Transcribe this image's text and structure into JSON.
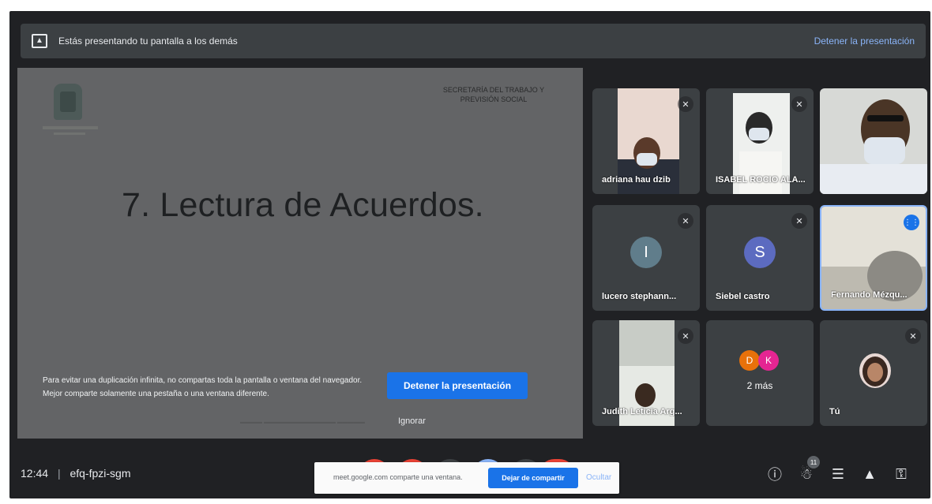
{
  "banner": {
    "text": "Estás presentando tu pantalla a los demás",
    "stop_label": "Detener la presentación"
  },
  "slide": {
    "org_name": "SECRETARÍA DEL TRABAJO Y PREVISIÓN SOCIAL",
    "title": "7. Lectura de Acuerdos.",
    "warning": "Para evitar una duplicación infinita, no compartas toda la pantalla o ventana del navegador. Mejor comparte solamente una pestaña o una ventana diferente.",
    "stop_button": "Detener la presentación",
    "ignore_label": "Ignorar"
  },
  "participants": [
    {
      "name": "adriana hau dzib",
      "muted": true
    },
    {
      "name": "ISABEL ROCIO ALA...",
      "muted": true
    },
    {
      "name": "",
      "muted": false
    },
    {
      "name": "lucero stephann...",
      "initial": "I",
      "avatar_color": "#607d8b",
      "muted": true
    },
    {
      "name": "Siebel castro",
      "initial": "S",
      "avatar_color": "#5c6bc0",
      "muted": true
    },
    {
      "name": "Fernando Mézqu...",
      "speaking": true
    },
    {
      "name": "Judith Leticia Arg...",
      "muted": true
    },
    {
      "name": "2 más",
      "initials": [
        "D",
        "K"
      ],
      "avatar_colors": [
        "#e8710a",
        "#e52592"
      ]
    },
    {
      "name": "Tú",
      "muted": true
    }
  ],
  "bottom_bar": {
    "time": "12:44",
    "separator": "|",
    "meeting_code": "efq-fpzi-sgm",
    "share_bar": {
      "text": "meet.google.com comparte una ventana.",
      "stop_share": "Dejar de compartir",
      "hide": "Ocultar"
    },
    "participant_count": "11",
    "control_colors": [
      "#ea4335",
      "#ea4335",
      "#3c4043",
      "#8ab4f8",
      "#3c4043",
      "#ea4335"
    ]
  },
  "colors": {
    "accent": "#1a73e8",
    "background": "#202124",
    "tile": "#3c4043",
    "slide": "#636466"
  }
}
